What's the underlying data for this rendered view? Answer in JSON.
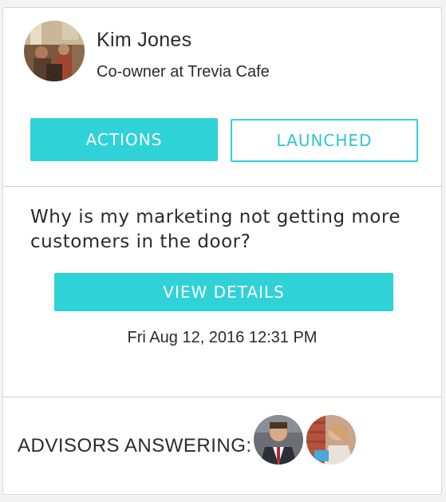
{
  "profile": {
    "name": "Kim Jones",
    "role": "Co-owner at Trevia Cafe"
  },
  "buttons": {
    "actions_label": "ACTIONS",
    "launched_label": "LAUNCHED"
  },
  "question": {
    "text": "Why is my marketing not getting more customers in the door?",
    "view_details_label": "VIEW DETAILS",
    "timestamp": "Fri Aug 12, 2016 12:31 PM"
  },
  "advisors": {
    "label": "ADVISORS ANSWERING:",
    "count": 2
  },
  "colors": {
    "accent": "#2fd2d7",
    "text": "#2b2b2b",
    "divider": "#cfcfcf"
  }
}
